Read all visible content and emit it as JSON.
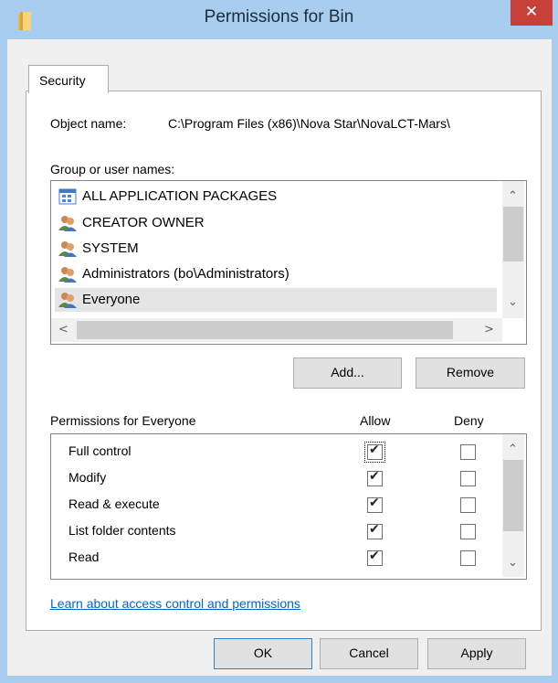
{
  "window": {
    "title": "Permissions for Bin",
    "close_glyph": "✕"
  },
  "tabs": [
    {
      "label": "Security"
    }
  ],
  "object": {
    "label": "Object name:",
    "value": "C:\\Program Files (x86)\\Nova Star\\NovaLCT-Mars\\"
  },
  "groups": {
    "label": "Group or user names:",
    "items": [
      {
        "label": "ALL APPLICATION PACKAGES",
        "icon": "app-packages-icon"
      },
      {
        "label": "CREATOR OWNER",
        "icon": "users-icon"
      },
      {
        "label": "SYSTEM",
        "icon": "users-icon"
      },
      {
        "label": "Administrators (bo\\Administrators)",
        "icon": "users-icon"
      },
      {
        "label": "Everyone",
        "icon": "users-icon",
        "selected": true
      }
    ]
  },
  "buttons": {
    "add": "Add...",
    "remove": "Remove",
    "ok": "OK",
    "cancel": "Cancel",
    "apply": "Apply"
  },
  "permissions": {
    "label": "Permissions for Everyone",
    "allow_header": "Allow",
    "deny_header": "Deny",
    "rows": [
      {
        "label": "Full control",
        "allow": true,
        "deny": false
      },
      {
        "label": "Modify",
        "allow": true,
        "deny": false
      },
      {
        "label": "Read & execute",
        "allow": true,
        "deny": false
      },
      {
        "label": "List folder contents",
        "allow": true,
        "deny": false
      },
      {
        "label": "Read",
        "allow": true,
        "deny": false
      }
    ]
  },
  "link": {
    "label": "Learn about access control and permissions"
  },
  "colors": {
    "title_bar": "#a9cdee",
    "close_button": "#c7413a",
    "link": "#0066cc"
  }
}
